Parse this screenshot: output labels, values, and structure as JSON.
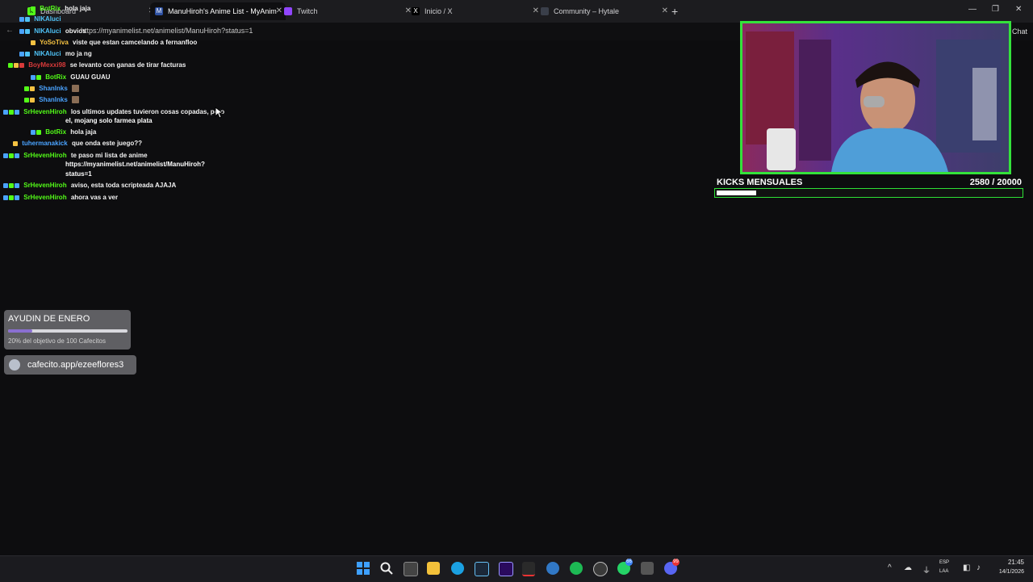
{
  "browser": {
    "tabs": [
      {
        "label": "Dashboard",
        "active": false
      },
      {
        "label": "ManuHiroh's Anime List - MyAnim",
        "active": true
      },
      {
        "label": "Twitch",
        "active": false
      },
      {
        "label": "Inicio / X",
        "active": false
      },
      {
        "label": "Community – Hytale",
        "active": false
      }
    ],
    "url": "https://myanimelist.net/animelist/ManuHiroh?status=1",
    "chat_label": "Chat"
  },
  "chat": {
    "messages": [
      {
        "user": "BotRix",
        "user_color": "#53fc18",
        "text": "hola jaja"
      },
      {
        "user": "NIKAluci",
        "user_color": "#4fc3f7",
        "text": ""
      },
      {
        "user": "NIKAluci",
        "user_color": "#4fc3f7",
        "text": "obvios"
      },
      {
        "user": "YoSoTiva",
        "user_color": "#f5c242",
        "text": "viste que estan camcelando a fernanfloo"
      },
      {
        "user": "NIKAluci",
        "user_color": "#4fc3f7",
        "text": "mo ja ng"
      },
      {
        "user": "BoyMexxi98",
        "user_color": "#d83a3a",
        "text": "se levanto con ganas de tirar facturas"
      },
      {
        "user": "BotRix",
        "user_color": "#53fc18",
        "text": "GUAU GUAU"
      },
      {
        "user": "Shanlnks",
        "user_color": "#4aa3ff",
        "text": ""
      },
      {
        "user": "Shanlnks",
        "user_color": "#4aa3ff",
        "text": ""
      },
      {
        "user": "SrHevenHiroh",
        "user_color": "#53fc18",
        "text": "los ultimos updates tuvieron cosas copadas, pero",
        "text2": "el, mojang solo farmea plata"
      },
      {
        "user": "BotRix",
        "user_color": "#53fc18",
        "text": "hola jaja"
      },
      {
        "user": "tuhermanakick",
        "user_color": "#4aa3ff",
        "text": "que onda este juego??"
      },
      {
        "user": "SrHevenHiroh",
        "user_color": "#53fc18",
        "text": "te paso mi lista de anime",
        "text2": "https://myanimelist.net/animelist/ManuHiroh?",
        "text3": "status=1"
      },
      {
        "user": "SrHevenHiroh",
        "user_color": "#53fc18",
        "text": "aviso, esta toda scripteada AJAJA"
      },
      {
        "user": "SrHevenHiroh",
        "user_color": "#53fc18",
        "text": "ahora vas a ver"
      }
    ]
  },
  "kicks": {
    "title": "KICKS MENSUALES",
    "count": "2580  / 20000",
    "progress": 0.129,
    "accent": "#2ee036"
  },
  "goal": {
    "title": "AYUDIN DE ENERO",
    "subtitle": "20% del objetivo de 100 Cafecitos",
    "progress": 0.2,
    "bar_color": "#8a6fd1"
  },
  "cafecito": {
    "label": "cafecito.app/ezeeflores3"
  },
  "taskbar": {
    "lang1": "ESP",
    "lang2": "LAA",
    "time": "21:45",
    "date": "14/1/2026",
    "whatsapp_badge": "66",
    "discord_badge": "99"
  }
}
